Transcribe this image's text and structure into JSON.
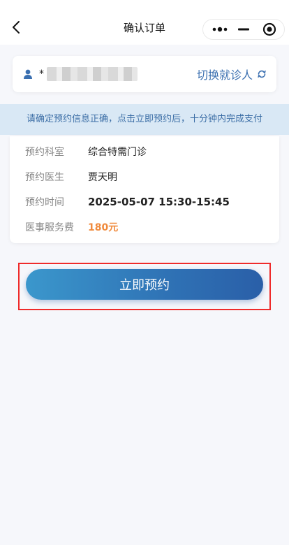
{
  "nav": {
    "title": "确认订单",
    "back_icon": "chevron-left-icon",
    "more_icon": "more-dots-icon",
    "minimize_icon": "minimize-icon",
    "close_icon": "target-close-icon"
  },
  "patient": {
    "icon": "user-icon",
    "name_prefix": "*",
    "switch_label": "切换就诊人",
    "switch_icon": "refresh-icon"
  },
  "notice": {
    "text": "请确定预约信息正确，点击立即预约后，十分钟内完成支付"
  },
  "order": {
    "rows": [
      {
        "label": "预约科室",
        "value": "综合特需门诊"
      },
      {
        "label": "预约医生",
        "value": "贾天明"
      },
      {
        "label": "预约时间",
        "value": "2025-05-07 15:30-15:45"
      },
      {
        "label": "医事服务费",
        "value": "180元"
      }
    ]
  },
  "actions": {
    "book_label": "立即预约"
  },
  "colors": {
    "accent_blue": "#2f72b5",
    "fee_orange": "#f08a3c",
    "notice_bg": "#d9e8f5",
    "highlight_red": "#ef2b2b"
  }
}
